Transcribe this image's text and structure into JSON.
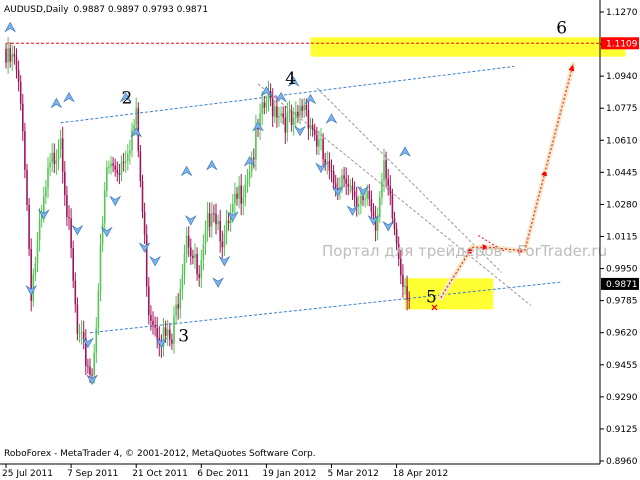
{
  "header": {
    "symbol": "AUDUSD,Daily",
    "ohlc": "0.9887 0.9897 0.9793 0.9871"
  },
  "footer": {
    "copyright": "RoboForex - MetaTrader 4, © 2001-2012, MetaQuotes Software Corp."
  },
  "watermark": "Портал для трейдеров - ForTrader.ru",
  "chart_data": {
    "type": "candlestick",
    "y_ticks": [
      1.127,
      1.1105,
      1.094,
      1.0775,
      1.061,
      1.0445,
      1.028,
      1.0115,
      0.995,
      0.9785,
      0.962,
      0.9455,
      0.929,
      0.9125,
      0.896
    ],
    "y_tick_labels": [
      "1.1270",
      "1.1105",
      "1.0940",
      "1.0775",
      "1.0610",
      "1.0445",
      "1.0280",
      "1.0115",
      "0.9950",
      "0.9785",
      "0.9620",
      "0.9455",
      "0.9290",
      "0.9125",
      "0.8960"
    ],
    "ylim": [
      0.896,
      1.127
    ],
    "x_labels": [
      "25 Jul 2011",
      "7 Sep 2011",
      "21 Oct 2011",
      "6 Dec 2011",
      "19 Jan 2012",
      "5 Mar 2012",
      "18 Apr 2012"
    ],
    "x_label_bars": [
      0,
      31,
      62,
      93,
      124,
      155,
      186
    ],
    "bar_count": 198,
    "last_bar": 192,
    "price_labels": [
      {
        "text": "1.1109",
        "value": 1.1109,
        "color": "#ff0000"
      },
      {
        "text": "0.9871",
        "value": 0.9871,
        "color": "#000000"
      }
    ],
    "candle_colors": {
      "bull": "#55c455",
      "bear": "#a0155a"
    },
    "wave_labels": [
      {
        "text": "2",
        "bar": 55,
        "value": 1.08
      },
      {
        "text": "3",
        "bar": 82,
        "value": 0.9575
      },
      {
        "text": "4",
        "bar": 133,
        "value": 1.09
      },
      {
        "text": "5",
        "bar": 200,
        "value": 0.9775
      },
      {
        "text": "6",
        "bar": 262,
        "value": 1.116
      }
    ],
    "pivots": [
      [
        0,
        1.105
      ],
      [
        4,
        1.105
      ],
      [
        8,
        1.075
      ],
      [
        12,
        0.989
      ],
      [
        20,
        1.045
      ],
      [
        26,
        1.07
      ],
      [
        34,
        0.964
      ],
      [
        41,
        0.945
      ],
      [
        48,
        1.05
      ],
      [
        54,
        1.052
      ],
      [
        62,
        1.075
      ],
      [
        68,
        0.98
      ],
      [
        74,
        0.965
      ],
      [
        79,
        0.96
      ],
      [
        86,
        1.02
      ],
      [
        92,
        0.99
      ],
      [
        98,
        1.035
      ],
      [
        104,
        1.013
      ],
      [
        112,
        1.04
      ],
      [
        118,
        1.06
      ],
      [
        124,
        1.085
      ],
      [
        130,
        1.082
      ],
      [
        137,
        1.07
      ],
      [
        142,
        1.085
      ],
      [
        148,
        1.065
      ],
      [
        155,
        1.042
      ],
      [
        162,
        1.05
      ],
      [
        167,
        1.025
      ],
      [
        172,
        1.04
      ],
      [
        176,
        1.025
      ],
      [
        180,
        1.047
      ],
      [
        184,
        1.025
      ],
      [
        188,
        1.0
      ],
      [
        192,
        0.986
      ]
    ],
    "fractals": [
      {
        "bar": 2,
        "value": 1.119,
        "dir": "up"
      },
      {
        "bar": 12,
        "value": 0.984,
        "dir": "down"
      },
      {
        "bar": 24,
        "value": 1.08,
        "dir": "up"
      },
      {
        "bar": 18,
        "value": 1.023,
        "dir": "down"
      },
      {
        "bar": 30,
        "value": 1.083,
        "dir": "up"
      },
      {
        "bar": 34,
        "value": 1.015,
        "dir": "down"
      },
      {
        "bar": 41,
        "value": 0.938,
        "dir": "down"
      },
      {
        "bar": 39,
        "value": 0.957,
        "dir": "down"
      },
      {
        "bar": 48,
        "value": 1.014,
        "dir": "down"
      },
      {
        "bar": 57,
        "value": 1.083,
        "dir": "up"
      },
      {
        "bar": 52,
        "value": 1.03,
        "dir": "down"
      },
      {
        "bar": 62,
        "value": 1.065,
        "dir": "up"
      },
      {
        "bar": 66,
        "value": 1.006,
        "dir": "down"
      },
      {
        "bar": 71,
        "value": 0.999,
        "dir": "down"
      },
      {
        "bar": 74,
        "value": 0.957,
        "dir": "down"
      },
      {
        "bar": 86,
        "value": 1.045,
        "dir": "up"
      },
      {
        "bar": 88,
        "value": 1.02,
        "dir": "down"
      },
      {
        "bar": 98,
        "value": 1.048,
        "dir": "up"
      },
      {
        "bar": 101,
        "value": 0.988,
        "dir": "down"
      },
      {
        "bar": 104,
        "value": 0.999,
        "dir": "down"
      },
      {
        "bar": 108,
        "value": 1.022,
        "dir": "down"
      },
      {
        "bar": 116,
        "value": 1.05,
        "dir": "up"
      },
      {
        "bar": 120,
        "value": 1.068,
        "dir": "up"
      },
      {
        "bar": 124,
        "value": 1.086,
        "dir": "up"
      },
      {
        "bar": 131,
        "value": 1.083,
        "dir": "up"
      },
      {
        "bar": 137,
        "value": 1.091,
        "dir": "up"
      },
      {
        "bar": 140,
        "value": 1.066,
        "dir": "down"
      },
      {
        "bar": 145,
        "value": 1.082,
        "dir": "up"
      },
      {
        "bar": 150,
        "value": 1.047,
        "dir": "down"
      },
      {
        "bar": 155,
        "value": 1.072,
        "dir": "up"
      },
      {
        "bar": 158,
        "value": 1.035,
        "dir": "down"
      },
      {
        "bar": 165,
        "value": 1.025,
        "dir": "down"
      },
      {
        "bar": 170,
        "value": 1.035,
        "dir": "down"
      },
      {
        "bar": 175,
        "value": 1.02,
        "dir": "down"
      },
      {
        "bar": 182,
        "value": 1.017,
        "dir": "down"
      },
      {
        "bar": 190,
        "value": 1.055,
        "dir": "up"
      }
    ],
    "channel_lines": [
      {
        "name": "upper-channel",
        "color": "#3a7fcf",
        "p1": [
          26,
          1.07
        ],
        "p2": [
          242,
          1.099
        ]
      },
      {
        "name": "lower-channel",
        "color": "#3a7fcf",
        "p1": [
          40,
          0.962
        ],
        "p2": [
          264,
          0.988
        ]
      },
      {
        "name": "descending-channel-top",
        "color": "#999999",
        "p1": [
          148,
          1.088
        ],
        "p2": [
          236,
          0.993
        ]
      },
      {
        "name": "descending-channel-bottom",
        "color": "#999999",
        "p1": [
          120,
          1.09
        ],
        "p2": [
          250,
          0.976
        ]
      },
      {
        "name": "target-level",
        "color": "#ff0000",
        "p1": [
          0,
          1.1109
        ],
        "p2": [
          295,
          1.1109
        ]
      }
    ],
    "zones": [
      {
        "name": "target-zone-6",
        "color": "#ffff33",
        "x1": 145,
        "x2": 295,
        "y1": 1.114,
        "y2": 1.104
      },
      {
        "name": "target-zone-5",
        "color": "#ffff33",
        "x1": 190,
        "x2": 232,
        "y1": 0.99,
        "y2": 0.974
      }
    ],
    "forecast_path": [
      [
        207,
        0.98
      ],
      [
        222,
        1.006
      ],
      [
        230,
        1.006
      ],
      [
        247,
        1.004
      ],
      [
        257,
        1.046
      ],
      [
        270,
        1.1
      ]
    ],
    "forecast_dashes": [
      [
        225,
        1.012
      ],
      [
        237,
        1.004
      ]
    ],
    "cross_marker": {
      "bar": 204,
      "value": 0.975,
      "color": "#ff0000"
    }
  }
}
